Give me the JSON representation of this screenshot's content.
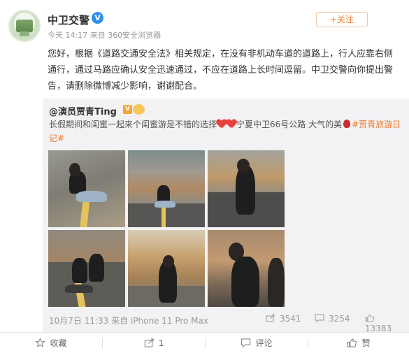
{
  "post": {
    "author": "中卫交警",
    "verified_badge": "V",
    "meta": "今天 14:17 来自 360安全浏览器",
    "follow_label": "+关注",
    "text": "您好，根据《道路交通安全法》相关规定，在没有非机动车道的道路上，行人应靠右侧通行，通过马路应确认安全迅速通过，不应在道路上长时间逗留。中卫交警向你提出警告，请删除微博减少影响，谢谢配合。"
  },
  "repost": {
    "author": "@演员贾青Ting",
    "badge": "V",
    "text_part1": "长假期间和闺蜜一起来个闺蜜游是不错的选择",
    "text_part2": "宁夏中卫66号公路 大气的美",
    "hashtag": "#贾青旅游日记#",
    "time_source": "10月7日 11:33 来自 iPhone 11 Pro Max",
    "stats": {
      "reposts": "3541",
      "comments": "3254",
      "likes": "13383"
    }
  },
  "actions": {
    "favorite": "收藏",
    "repost": "1",
    "comment": "评论",
    "like": "赞"
  },
  "colors": {
    "accent": "#ef7a2a",
    "verified_blue": "#2e8fe8",
    "verified_gold": "#f3a633",
    "repost_bg": "#f2f2f5"
  }
}
